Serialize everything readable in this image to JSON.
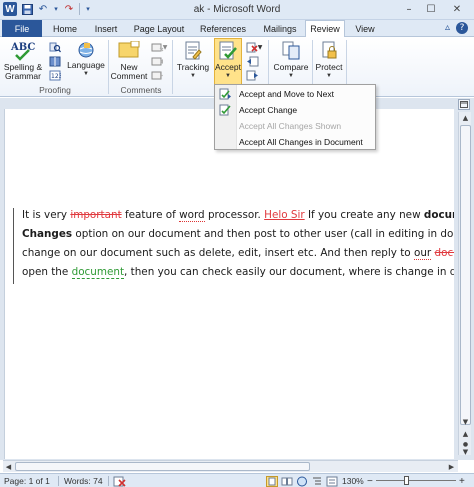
{
  "window": {
    "title": "ak  -  Microsoft Word",
    "minimize_glyph": "–",
    "maximize_glyph": "☐",
    "close_glyph": "✕"
  },
  "quick_access": {
    "app_icon_letter": "W",
    "save_glyph": "💾",
    "undo_glyph": "↶",
    "redo_glyph": "↷",
    "customize_glyph": "▾"
  },
  "tabs": [
    {
      "label": "File"
    },
    {
      "label": "Home"
    },
    {
      "label": "Insert"
    },
    {
      "label": "Page Layout"
    },
    {
      "label": "References"
    },
    {
      "label": "Mailings"
    },
    {
      "label": "Review"
    },
    {
      "label": "View"
    }
  ],
  "active_tab": "Review",
  "ribbon_right": {
    "minimize_glyph": "▵",
    "help_glyph": "?"
  },
  "ribbon": {
    "spelling": {
      "line1": "Spelling &",
      "line2": "Grammar"
    },
    "language": {
      "label": "Language"
    },
    "new_comment": {
      "line1": "New",
      "line2": "Comment"
    },
    "tracking": {
      "label": "Tracking"
    },
    "accept": {
      "label": "Accept"
    },
    "compare": {
      "label": "Compare"
    },
    "protect": {
      "label": "Protect"
    },
    "groups": {
      "proofing": "Proofing",
      "comments": "Comments"
    }
  },
  "accept_menu": [
    {
      "label": "Accept and Move to Next",
      "enabled": true,
      "icon": "accept-next-icon"
    },
    {
      "label": "Accept Change",
      "enabled": true,
      "icon": "accept-change-icon"
    },
    {
      "label": "Accept All Changes Shown",
      "enabled": false,
      "icon": ""
    },
    {
      "label": "Accept All Changes in Document",
      "enabled": true,
      "icon": ""
    }
  ],
  "document": {
    "line1": {
      "a": "It is very ",
      "deleted": "important",
      "b": " feature of ",
      "c": "word",
      "d": " processor. ",
      "inserted": "Helo Sir",
      "e": "  If you create any new ",
      "f": "documen"
    },
    "line2": {
      "bold": "Changes",
      "rest": " option on our document and then post to other user (call in editing in docume"
    },
    "line3": {
      "a": "change on our document such as delete, edit, insert etc. And then reply to ",
      "b": "our",
      "c": " ",
      "deleted": "documen"
    },
    "line4": {
      "a": "open the ",
      "inserted": "document",
      "b": ", then you can check easily our document, where is change in docum"
    }
  },
  "status": {
    "page": "Page: 1 of 1",
    "words": "Words: 74",
    "zoom": "130%",
    "zoom_minus": "−",
    "zoom_plus": "+"
  },
  "colors": {
    "accent": "#2b579a",
    "deletion": "#e0393e",
    "insertion_green": "#2f9a35",
    "accept_highlight": "#ffe28a"
  }
}
